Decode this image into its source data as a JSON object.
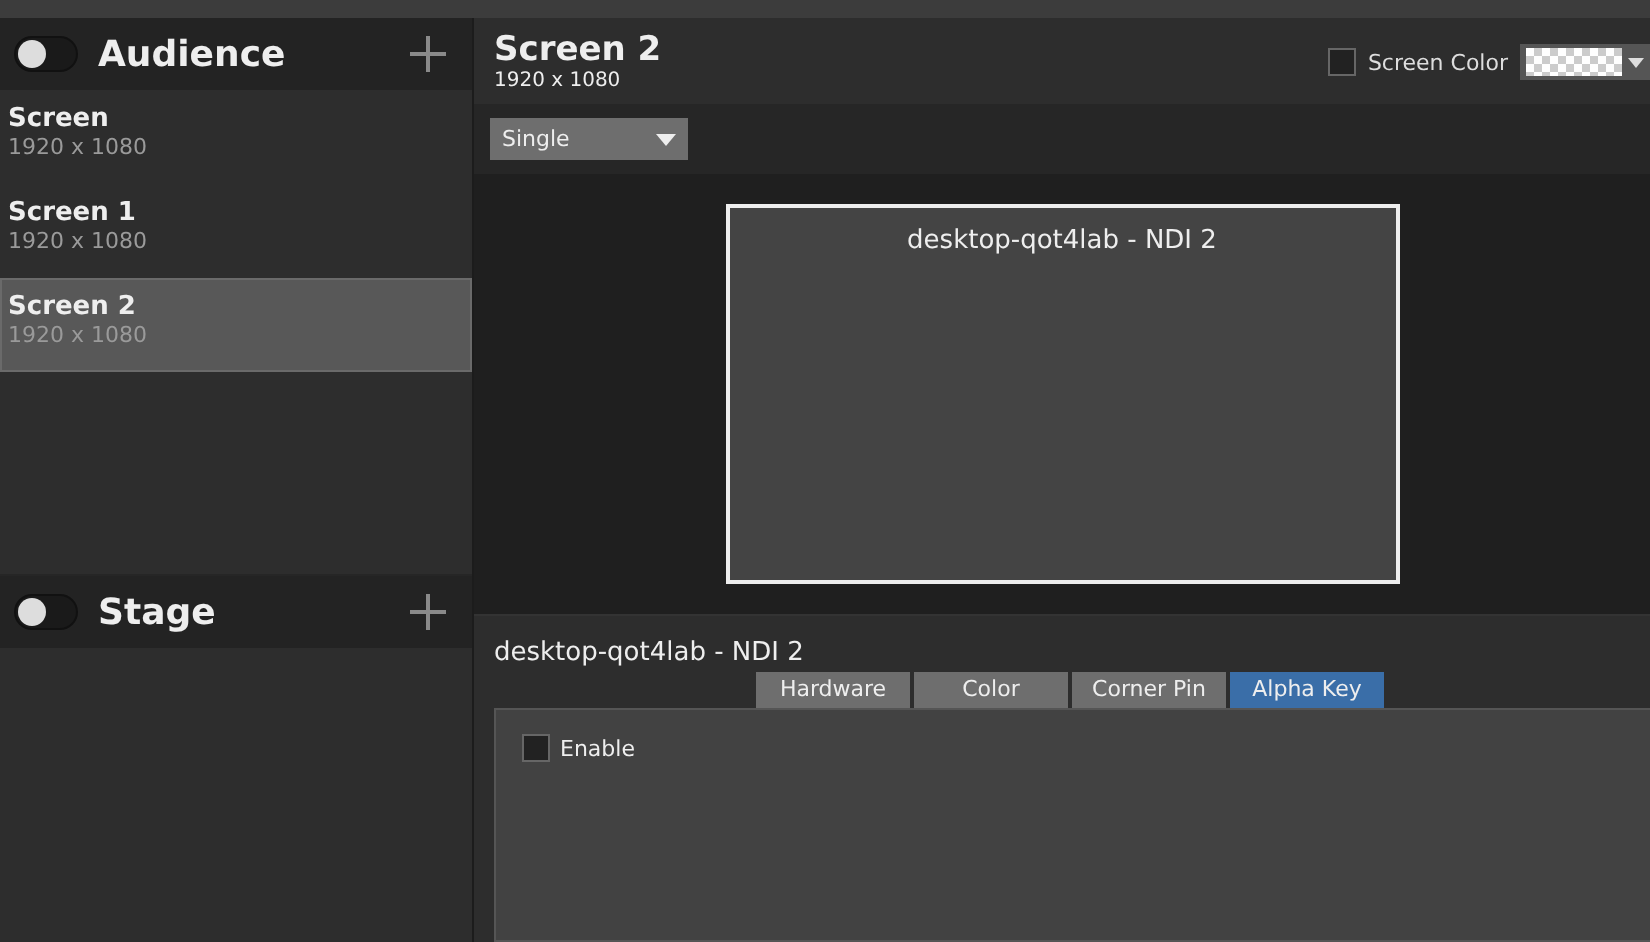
{
  "groups": [
    {
      "title": "Audience",
      "on": false,
      "items": [
        {
          "name": "Screen",
          "size": "1920 x 1080",
          "selected": false
        },
        {
          "name": "Screen 1",
          "size": "1920 x 1080",
          "selected": false
        },
        {
          "name": "Screen 2",
          "size": "1920 x 1080",
          "selected": true
        }
      ]
    },
    {
      "title": "Stage",
      "on": false
    }
  ],
  "screen": {
    "title": "Screen 2",
    "size": "1920 x 1080",
    "screen_color": {
      "label": "Screen Color",
      "checked": false
    },
    "layout": "Single"
  },
  "preview": {
    "label": "desktop-qot4lab - NDI 2"
  },
  "source": {
    "title": "desktop-qot4lab - NDI 2",
    "tabs": [
      {
        "label": "Hardware",
        "selected": false
      },
      {
        "label": "Color",
        "selected": false
      },
      {
        "label": "Corner Pin",
        "selected": false
      },
      {
        "label": "Alpha Key",
        "selected": true
      }
    ],
    "enable": {
      "label": "Enable",
      "checked": false
    }
  }
}
